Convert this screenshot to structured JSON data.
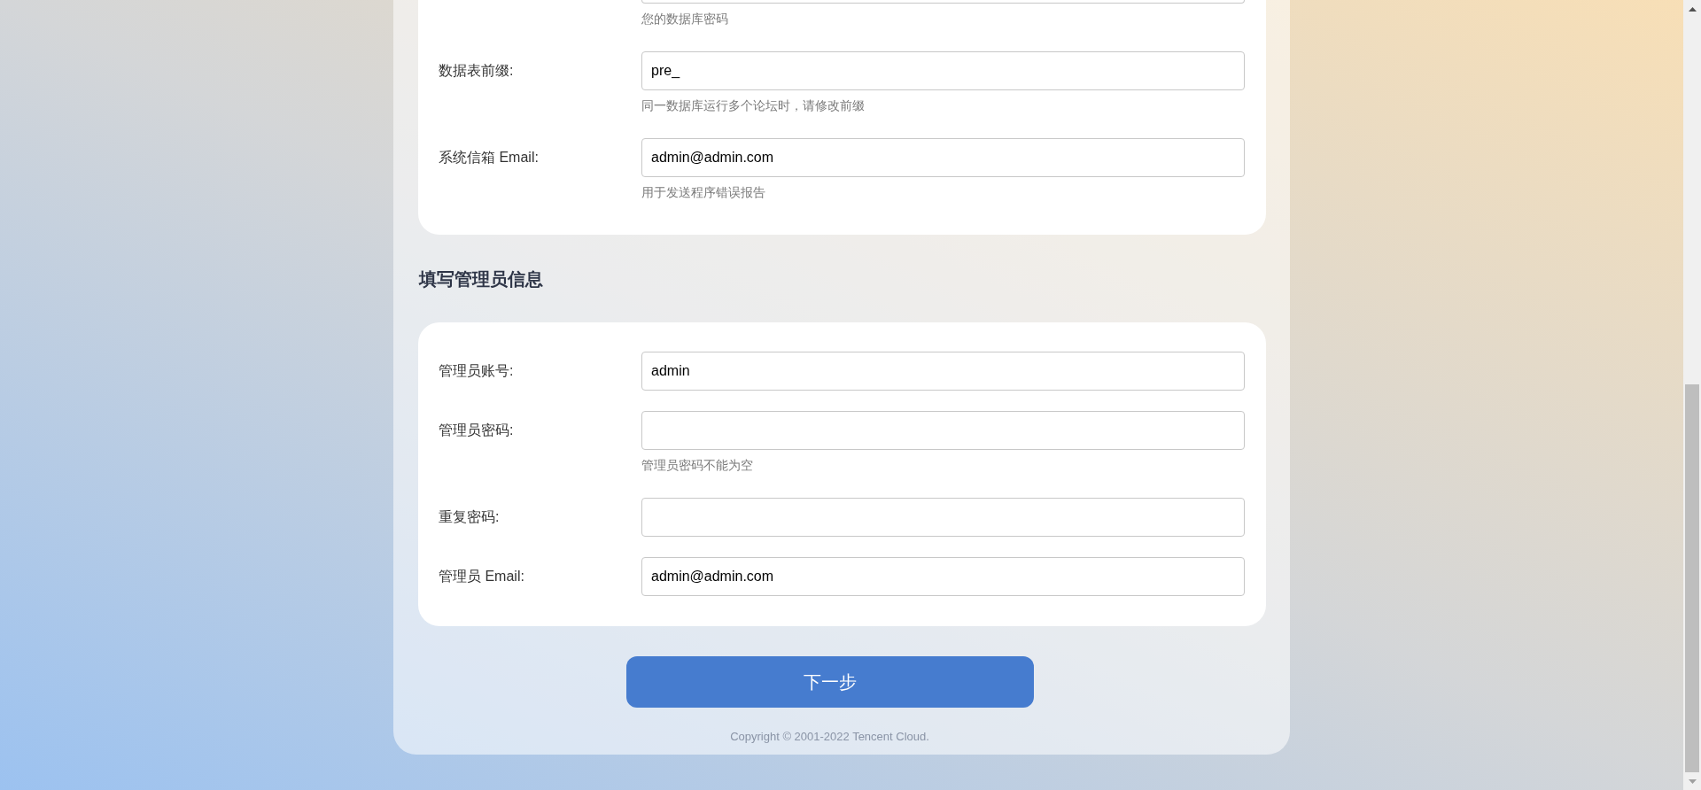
{
  "database_settings": {
    "fields": [
      {
        "hint": "您的数据库密码"
      },
      {
        "label": "数据表前缀:",
        "value": "pre_",
        "hint": "同一数据库运行多个论坛时，请修改前缀"
      },
      {
        "label": "系统信箱 Email:",
        "value": "admin@admin.com",
        "hint": "用于发送程序错误报告"
      }
    ]
  },
  "admin_settings": {
    "title": "填写管理员信息",
    "fields": [
      {
        "label": "管理员账号:",
        "value": "admin"
      },
      {
        "label": "管理员密码:",
        "hint": "管理员密码不能为空"
      },
      {
        "label": "重复密码:"
      },
      {
        "label": "管理员 Email:",
        "value": "admin@admin.com"
      }
    ]
  },
  "next_button": "下一步",
  "copyright": "Copyright © 2001-2022 Tencent Cloud."
}
